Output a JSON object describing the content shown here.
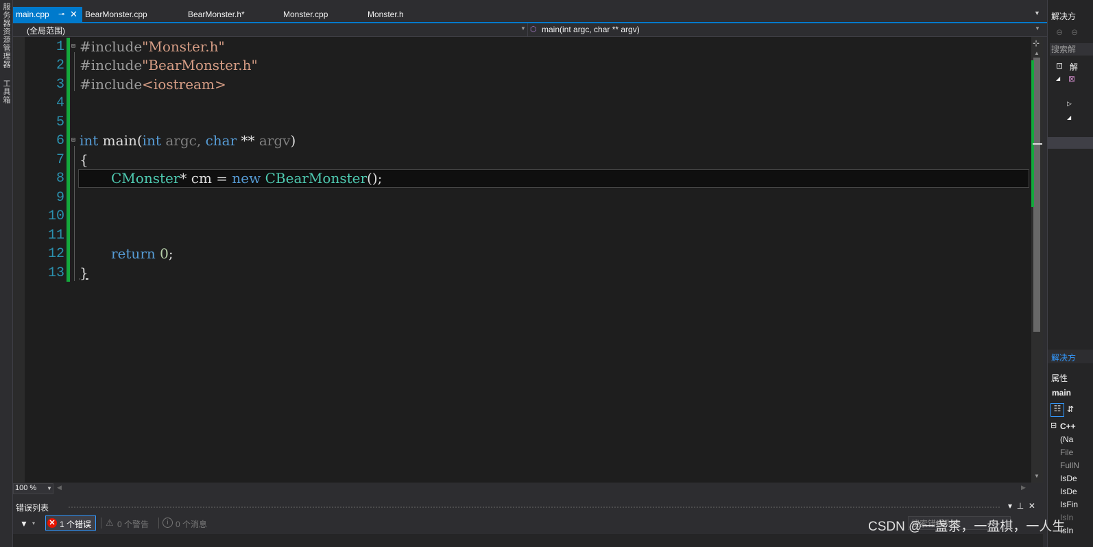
{
  "left_strip": {
    "items": [
      "服务器资源管理器",
      "工具箱"
    ]
  },
  "tabs": [
    {
      "label": "main.cpp",
      "active": true
    },
    {
      "label": "BearMonster.cpp",
      "active": false
    },
    {
      "label": "BearMonster.h*",
      "active": false
    },
    {
      "label": "Monster.cpp",
      "active": false
    },
    {
      "label": "Monster.h",
      "active": false
    }
  ],
  "navbar": {
    "scope": "(全局范围)",
    "function": "main(int argc, char ** argv)"
  },
  "editor": {
    "line_numbers": [
      "1",
      "2",
      "3",
      "4",
      "5",
      "6",
      "7",
      "8",
      "9",
      "10",
      "11",
      "12",
      "13"
    ],
    "lines": {
      "l1_pp": "#include",
      "l1_str": "\"Monster.h\"",
      "l2_pp": "#include",
      "l2_str": "\"BearMonster.h\"",
      "l3_pp": "#include",
      "l3_str": "<iostream>",
      "l6_kw1": "int",
      "l6_name": " main(",
      "l6_kw2": "int",
      "l6_p1": " argc",
      "l6_comma": ", ",
      "l6_kw3": "char",
      "l6_stars": " ** ",
      "l6_p2": "argv",
      "l6_close": ")",
      "l7": "{",
      "l8_ty1": "CMonster",
      "l8_mid": "* cm = ",
      "l8_kw": "new",
      "l8_sp": " ",
      "l8_ty2": "CBearMonster",
      "l8_end": "();",
      "l12_kw": "return",
      "l12_sp": " ",
      "l12_num": "0",
      "l12_end": ";",
      "l13": "}"
    }
  },
  "zoom": {
    "value": "100 %"
  },
  "error_list": {
    "title": "错误列表",
    "errors": "1 个错误",
    "warnings": "0 个警告",
    "messages": "0 个消息",
    "search_placeholder": "搜索错误列表"
  },
  "right_panel": {
    "solution_title": "解决方",
    "search": "搜索解",
    "tree_item": "解",
    "solution_tab": "解决方",
    "properties_title": "属性",
    "object": "main",
    "group": "C++",
    "props": [
      "(Na",
      "File",
      "FullN",
      "IsDe",
      "IsDe",
      "IsFin",
      "IsIn",
      "IsIn"
    ]
  },
  "watermark": "CSDN @一盏茶，一盘棋，一人生"
}
